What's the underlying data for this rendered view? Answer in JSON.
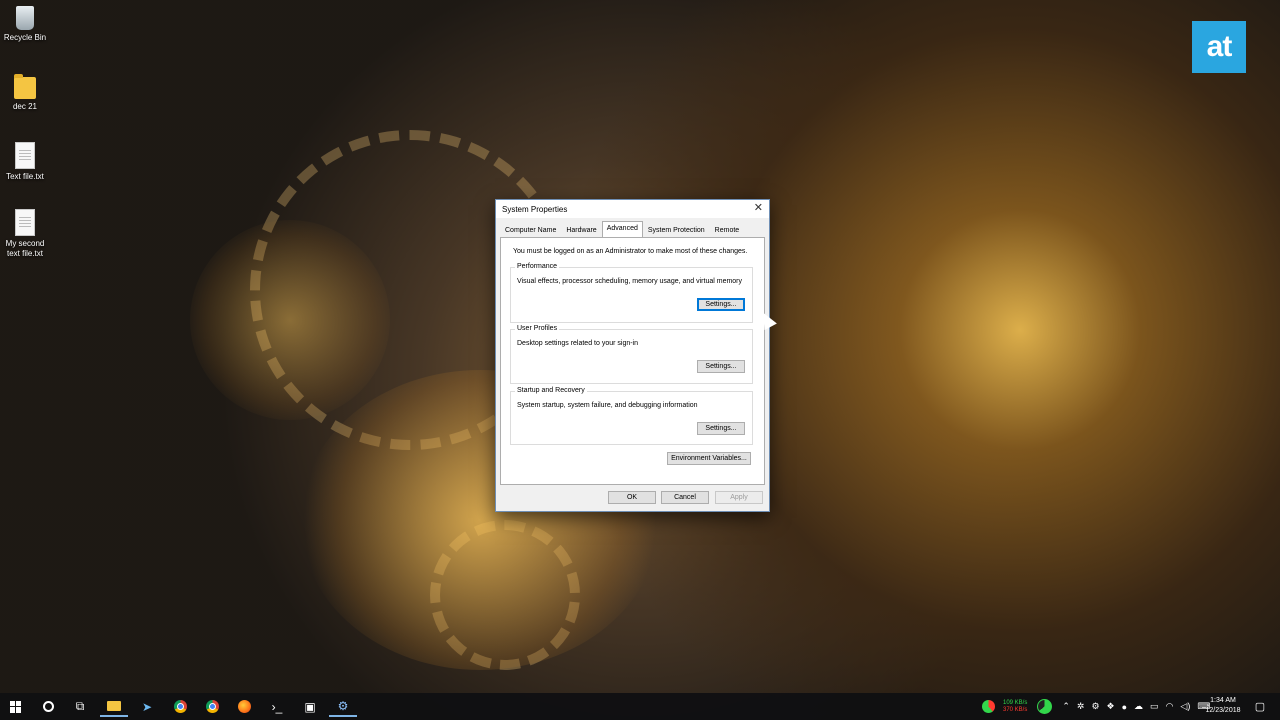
{
  "desktop": {
    "icons": [
      {
        "label": "Recycle Bin",
        "icon": "recycle-bin-icon"
      },
      {
        "label": "dec 21",
        "icon": "folder-icon"
      },
      {
        "label": "Text file.txt",
        "icon": "text-file-icon"
      },
      {
        "label": "My second text file.txt",
        "icon": "text-file-icon"
      }
    ],
    "logo_text": "at",
    "logo_color": "#2aa6e0"
  },
  "dialog": {
    "title": "System Properties",
    "tabs": [
      "Computer Name",
      "Hardware",
      "Advanced",
      "System Protection",
      "Remote"
    ],
    "active_tab": "Advanced",
    "notice": "You must be logged on as an Administrator to make most of these changes.",
    "groups": [
      {
        "title": "Performance",
        "description": "Visual effects, processor scheduling, memory usage, and virtual memory",
        "button": "Settings..."
      },
      {
        "title": "User Profiles",
        "description": "Desktop settings related to your sign-in",
        "button": "Settings..."
      },
      {
        "title": "Startup and Recovery",
        "description": "System startup, system failure, and debugging information",
        "button": "Settings..."
      }
    ],
    "env_button": "Environment Variables...",
    "ok": "OK",
    "cancel": "Cancel",
    "apply": "Apply"
  },
  "taskbar": {
    "apps": [
      "windows-start-icon",
      "cortana-icon",
      "task-view-icon",
      "file-explorer-icon",
      "pin-app-icon",
      "chrome-icon",
      "chrome-icon",
      "firefox-icon",
      "terminal-icon",
      "window-app-icon",
      "control-panel-icon"
    ],
    "net_up": "109 KB/s",
    "net_down": "370 KB/s",
    "time": "1:34 AM",
    "date": "12/23/2018",
    "accent": "#7fb5e6"
  }
}
